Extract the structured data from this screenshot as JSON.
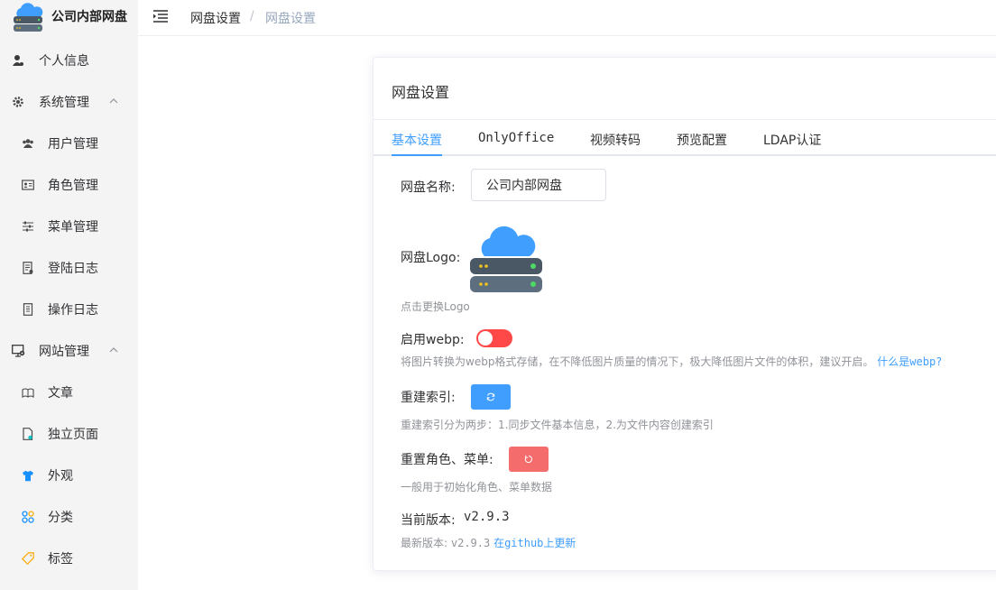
{
  "app": {
    "title": "公司内部网盘"
  },
  "sidebar": {
    "items": [
      {
        "label": "个人信息",
        "icon": "user-icon"
      },
      {
        "label": "系统管理",
        "icon": "gear-icon"
      },
      {
        "label": "用户管理",
        "icon": "users-icon"
      },
      {
        "label": "角色管理",
        "icon": "id-card-icon"
      },
      {
        "label": "菜单管理",
        "icon": "sliders-icon"
      },
      {
        "label": "登陆日志",
        "icon": "log-icon"
      },
      {
        "label": "操作日志",
        "icon": "log-icon"
      },
      {
        "label": "网站管理",
        "icon": "monitor-gear-icon"
      },
      {
        "label": "文章",
        "icon": "article-icon"
      },
      {
        "label": "独立页面",
        "icon": "page-icon"
      },
      {
        "label": "外观",
        "icon": "shirt-icon"
      },
      {
        "label": "分类",
        "icon": "category-icon"
      },
      {
        "label": "标签",
        "icon": "tag-icon"
      }
    ]
  },
  "breadcrumb": {
    "items": [
      "网盘设置",
      "网盘设置"
    ],
    "separator": "/"
  },
  "card": {
    "title": "网盘设置",
    "tabs": [
      "基本设置",
      "OnlyOffice",
      "视频转码",
      "预览配置",
      "LDAP认证"
    ]
  },
  "form": {
    "name_label": "网盘名称:",
    "name_value": "公司内部网盘",
    "logo_label": "网盘Logo:",
    "logo_hint": "点击更换Logo",
    "webp_label": "启用webp:",
    "webp_hint": "将图片转换为webp格式存储，在不降低图片质量的情况下，极大降低图片文件的体积，建议开启。",
    "webp_link": "什么是webp?",
    "rebuild_label": "重建索引:",
    "rebuild_hint": "重建索引分为两步：1.同步文件基本信息，2.为文件内容创建索引",
    "reset_label": "重置角色、菜单:",
    "reset_hint": "一般用于初始化角色、菜单数据",
    "version_label": "当前版本:",
    "version_value": "v2.9.3",
    "latest_label": "最新版本:",
    "latest_value": "v2.9.3",
    "update_link": "在github上更新"
  },
  "colors": {
    "primary": "#409eff",
    "danger": "#f56c6c",
    "switch_off": "#ff4949",
    "sidebar_bg": "#f4f4f5"
  }
}
